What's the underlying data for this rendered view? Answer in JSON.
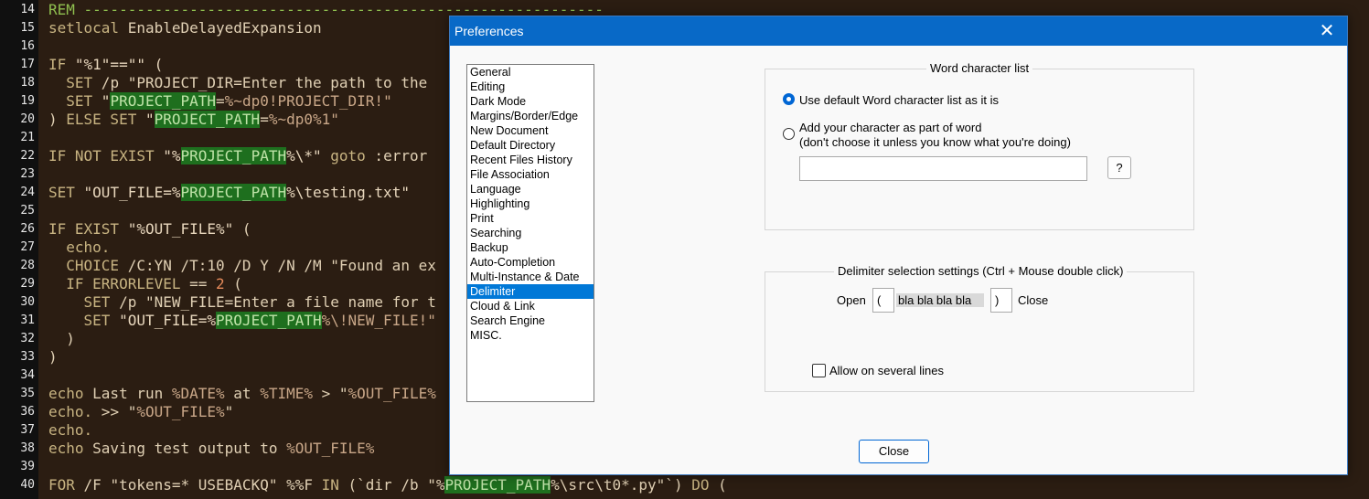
{
  "editor": {
    "lines": [
      {
        "n": "14",
        "t": [
          [
            "rem",
            "REM -----------------------------------------------------------"
          ]
        ]
      },
      {
        "n": "15",
        "t": [
          [
            "kw",
            "setlocal"
          ],
          [
            "tok",
            " EnableDelayedExpansion"
          ]
        ]
      },
      {
        "n": "16",
        "t": []
      },
      {
        "n": "17",
        "t": [
          [
            "kw",
            "IF"
          ],
          [
            "str",
            " \"%1\"==\"\" ("
          ]
        ]
      },
      {
        "n": "18",
        "t": [
          [
            "tok",
            "  "
          ],
          [
            "kw",
            "SET"
          ],
          [
            "tok",
            " /p \"PROJECT_DIR=Enter the path to the"
          ]
        ]
      },
      {
        "n": "19",
        "t": [
          [
            "tok",
            "  "
          ],
          [
            "kw",
            "SET"
          ],
          [
            "str",
            " \""
          ],
          [
            "hl",
            "PROJECT_PATH"
          ],
          [
            "tok",
            "="
          ],
          [
            "var",
            "%~dp0!PROJECT_DIR!\""
          ]
        ]
      },
      {
        "n": "20",
        "t": [
          [
            "tok",
            ") "
          ],
          [
            "kw",
            "ELSE SET"
          ],
          [
            "str",
            " \""
          ],
          [
            "hl",
            "PROJECT_PATH"
          ],
          [
            "tok",
            "="
          ],
          [
            "var",
            "%~dp0%1\""
          ]
        ]
      },
      {
        "n": "21",
        "t": []
      },
      {
        "n": "22",
        "t": [
          [
            "kw",
            "IF NOT EXIST"
          ],
          [
            "str",
            " \"%"
          ],
          [
            "hl",
            "PROJECT_PATH"
          ],
          [
            "str",
            "%\\*\""
          ],
          [
            "kw",
            " goto"
          ],
          [
            "tok",
            " :error"
          ]
        ]
      },
      {
        "n": "23",
        "t": []
      },
      {
        "n": "24",
        "t": [
          [
            "kw",
            "SET"
          ],
          [
            "str",
            " \"OUT_FILE=%"
          ],
          [
            "hl",
            "PROJECT_PATH"
          ],
          [
            "str",
            "%\\testing.txt\""
          ]
        ]
      },
      {
        "n": "25",
        "t": []
      },
      {
        "n": "26",
        "t": [
          [
            "kw",
            "IF EXIST"
          ],
          [
            "str",
            " \"%OUT_FILE%\""
          ],
          [
            "tok",
            " ("
          ]
        ]
      },
      {
        "n": "27",
        "t": [
          [
            "tok",
            "  "
          ],
          [
            "kw",
            "echo."
          ]
        ]
      },
      {
        "n": "28",
        "t": [
          [
            "tok",
            "  "
          ],
          [
            "kw",
            "CHOICE"
          ],
          [
            "tok",
            " /C:YN /T:10 /D Y /N /M \"Found an ex"
          ]
        ]
      },
      {
        "n": "29",
        "t": [
          [
            "tok",
            "  "
          ],
          [
            "kw",
            "IF ERRORLEVEL"
          ],
          [
            "tok",
            " == "
          ],
          [
            "num",
            "2"
          ],
          [
            "tok",
            " ("
          ]
        ]
      },
      {
        "n": "30",
        "t": [
          [
            "tok",
            "    "
          ],
          [
            "kw",
            "SET"
          ],
          [
            "tok",
            " /p \"NEW_FILE=Enter a file name for t"
          ]
        ]
      },
      {
        "n": "31",
        "t": [
          [
            "tok",
            "    "
          ],
          [
            "kw",
            "SET"
          ],
          [
            "str",
            " \"OUT_FILE=%"
          ],
          [
            "hl",
            "PROJECT_PATH"
          ],
          [
            "var",
            "%\\!NEW_FILE!\""
          ]
        ]
      },
      {
        "n": "32",
        "t": [
          [
            "tok",
            "  )"
          ]
        ]
      },
      {
        "n": "33",
        "t": [
          [
            "tok",
            ")"
          ]
        ]
      },
      {
        "n": "34",
        "t": []
      },
      {
        "n": "35",
        "t": [
          [
            "kw",
            "echo"
          ],
          [
            "tok",
            " Last run "
          ],
          [
            "var",
            "%DATE%"
          ],
          [
            "tok",
            " at "
          ],
          [
            "var",
            "%TIME%"
          ],
          [
            "tok",
            " > \""
          ],
          [
            "var",
            "%OUT_FILE%"
          ]
        ]
      },
      {
        "n": "36",
        "t": [
          [
            "kw",
            "echo."
          ],
          [
            "tok",
            " >> \""
          ],
          [
            "var",
            "%OUT_FILE%"
          ],
          [
            "tok",
            "\""
          ]
        ]
      },
      {
        "n": "37",
        "t": [
          [
            "kw",
            "echo."
          ]
        ]
      },
      {
        "n": "38",
        "t": [
          [
            "kw",
            "echo"
          ],
          [
            "tok",
            " Saving test output to "
          ],
          [
            "var",
            "%OUT_FILE%"
          ]
        ]
      },
      {
        "n": "39",
        "t": []
      },
      {
        "n": "40",
        "t": [
          [
            "kw",
            "FOR"
          ],
          [
            "tok",
            " /F \"tokens=* USEBACKQ\" %%F "
          ],
          [
            "kw",
            "IN"
          ],
          [
            "tok",
            " (`dir /b \"%"
          ],
          [
            "hl",
            "PROJECT_PATH"
          ],
          [
            "tok",
            "%\\src\\t0*.py\"`) "
          ],
          [
            "kw",
            "DO"
          ],
          [
            "tok",
            " ("
          ]
        ]
      }
    ]
  },
  "dialog": {
    "title": "Preferences",
    "close_glyph": "✕",
    "categories": [
      "General",
      "Editing",
      "Dark Mode",
      "Margins/Border/Edge",
      "New Document",
      "Default Directory",
      "Recent Files History",
      "File Association",
      "Language",
      "Highlighting",
      "Print",
      "Searching",
      "Backup",
      "Auto-Completion",
      "Multi-Instance & Date",
      "Delimiter",
      "Cloud & Link",
      "Search Engine",
      "MISC."
    ],
    "selected_category": "Delimiter",
    "word_group": {
      "title": "Word character list",
      "option_default": "Use default Word character list as it is",
      "option_custom_line1": "Add your character as part of word",
      "option_custom_line2": "(don't choose it unless you know what you're doing)",
      "custom_chars_value": "",
      "help_button": "?"
    },
    "delim_group": {
      "title": "Delimiter selection settings (Ctrl + Mouse double click)",
      "open_label": "Open",
      "open_value": "(",
      "preview": "bla bla bla bla",
      "close_value": ")",
      "close_label": "Close",
      "multiline_label": "Allow on several lines"
    },
    "close_button": "Close"
  }
}
